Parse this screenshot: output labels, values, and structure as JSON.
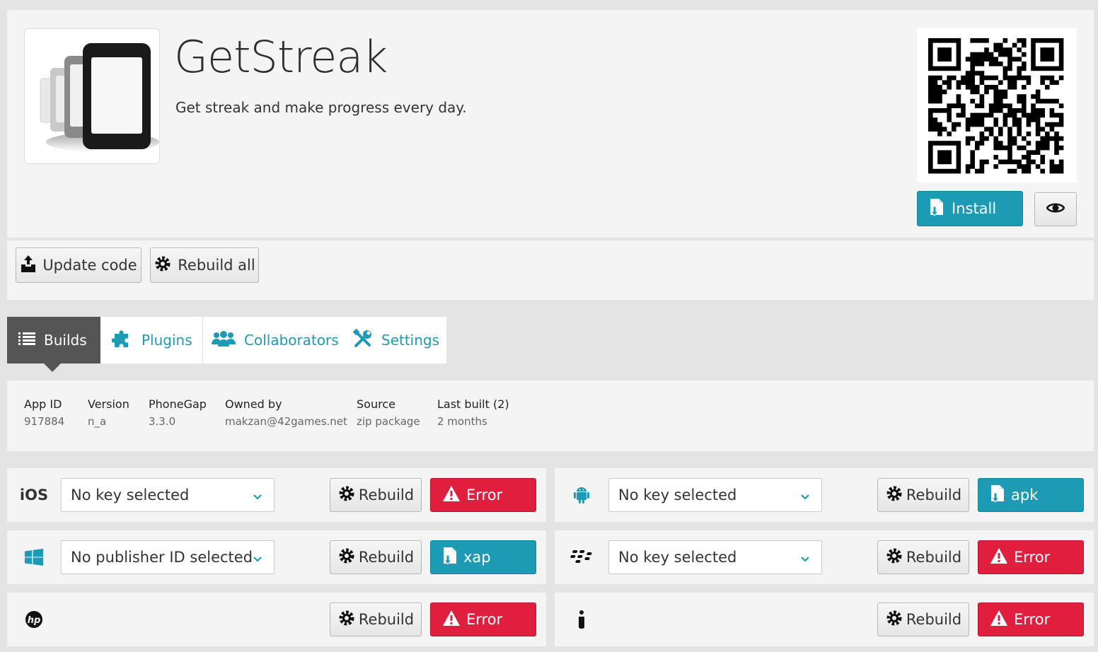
{
  "app": {
    "title": "GetStreak",
    "description": "Get streak and make progress every day.",
    "icon": "phonegap-app-icon"
  },
  "header_actions": {
    "install_label": "Install",
    "preview_icon": "eye-icon"
  },
  "toolbar": {
    "update_code_label": "Update code",
    "rebuild_all_label": "Rebuild all"
  },
  "tabs": [
    {
      "label": "Builds",
      "icon": "list-icon",
      "active": true
    },
    {
      "label": "Plugins",
      "icon": "puzzle-icon",
      "active": false
    },
    {
      "label": "Collaborators",
      "icon": "people-icon",
      "active": false
    },
    {
      "label": "Settings",
      "icon": "wrench-icon",
      "active": false
    }
  ],
  "info": [
    {
      "label": "App ID",
      "value": "917884"
    },
    {
      "label": "Version",
      "value": "n_a"
    },
    {
      "label": "PhoneGap",
      "value": "3.3.0"
    },
    {
      "label": "Owned by",
      "value": "makzan@42games.net"
    },
    {
      "label": "Source",
      "value": "zip package"
    },
    {
      "label": "Last built (2)",
      "value": "2 months"
    }
  ],
  "platforms": {
    "ios": {
      "label": "iOS",
      "select": "No key selected",
      "rebuild": "Rebuild",
      "status": "Error",
      "status_type": "error"
    },
    "android": {
      "icon": "android-icon",
      "select": "No key selected",
      "rebuild": "Rebuild",
      "status": "apk",
      "status_type": "download"
    },
    "windows": {
      "icon": "windows-icon",
      "select": "No publisher ID selected",
      "rebuild": "Rebuild",
      "status": "xap",
      "status_type": "download"
    },
    "blackberry": {
      "icon": "blackberry-icon",
      "select": "No key selected",
      "rebuild": "Rebuild",
      "status": "Error",
      "status_type": "error"
    },
    "webos": {
      "icon": "hp-icon",
      "rebuild": "Rebuild",
      "status": "Error",
      "status_type": "error"
    },
    "symbian": {
      "icon": "info-i-icon",
      "rebuild": "Rebuild",
      "status": "Error",
      "status_type": "error"
    }
  },
  "colors": {
    "accent": "#1d9bb5",
    "error": "#e01f3f",
    "tab_active": "#555555",
    "panel": "#f4f4f4",
    "background": "#e4e4e4"
  }
}
